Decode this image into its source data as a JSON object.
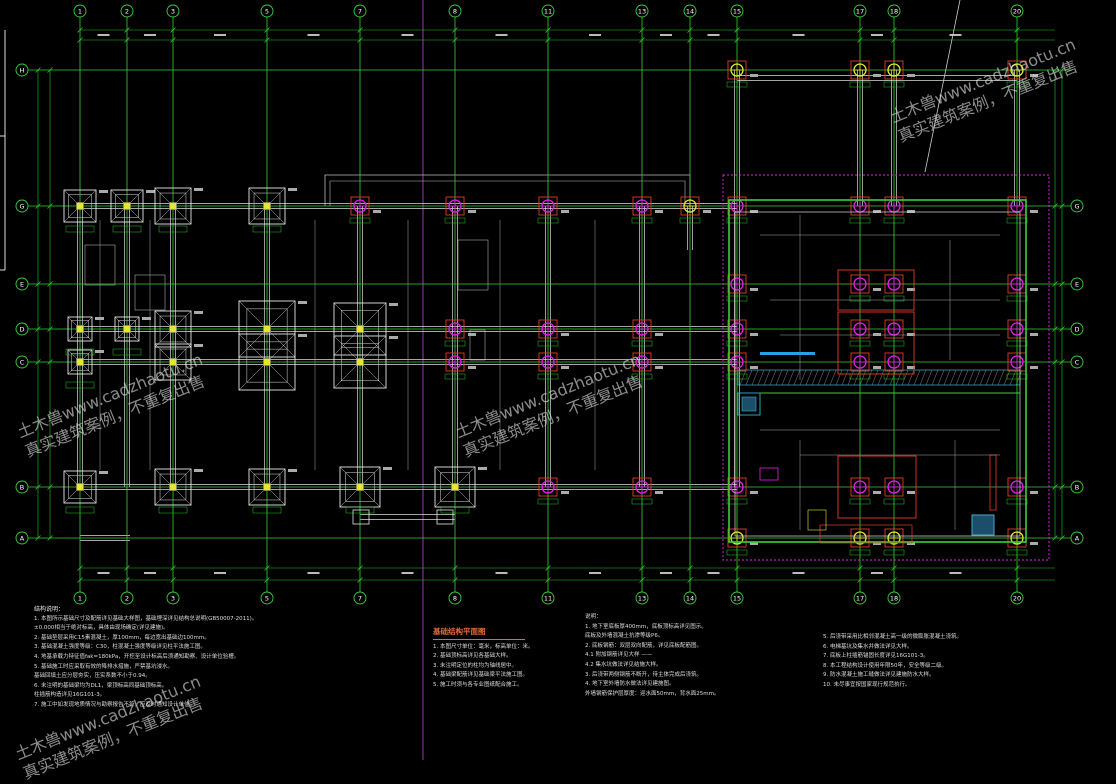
{
  "drawing": {
    "x_axes": [
      "1",
      "2",
      "3",
      "5",
      "7",
      "8",
      "11",
      "13",
      "14",
      "15",
      "17",
      "18",
      "20"
    ],
    "y_axes": [
      "H",
      "G",
      "E",
      "D",
      "C",
      "B",
      "A"
    ],
    "title": "基础结构平面图",
    "general_notes_heading": "结构说明：",
    "notes_left": [
      "1. 本图所示基础尺寸及配筋详见基础大样图，基础埋深详见结构总说明(GB50007-2011)。",
      "   ±0.000相当于绝对标高，具体由现场确定(详见建施)。",
      "2. 基础垫层采用C15素混凝土，厚100mm，每边宽出基础边100mm。",
      "3. 基础混凝土强度等级：C30，柱混凝土强度等级详见柱平法施工图。",
      "4. 地基承载力特征值fak=180kPa，开挖至设计标高后须通知勘察、设计单位验槽。",
      "5. 基础施工时应采取有效的降排水措施，严禁基坑浸水。",
      "   基础回填土应分层夯实，压实系数不小于0.94。",
      "6. 未注明的基础梁均为DL1，梁顶标高同基础顶标高。",
      "   柱插筋构造详见16G101-3。",
      "7. 施工中如发现地质情况与勘察报告不符，应及时通知设计单位。"
    ],
    "notes_mid": [
      "1. 本图尺寸单位：毫米，标高单位：米。",
      "2. 基础顶标高详见各基础大样。",
      "3. 未注明定位的柱均为轴线居中。",
      "4. 基础梁配筋详见基础梁平法施工图。",
      "5. 施工时须与各专业图纸配合施工。"
    ],
    "notes_right": [
      "说明：",
      "1. 地下室底板厚400mm，底板顶标高详见图示。",
      "   底板及外墙混凝土抗渗等级P6。",
      "2. 底板钢筋：双层双向配筋，详见底板配筋图。",
      "   4.1 附加钢筋详见大样 ——",
      "   4.2 集水坑做法详见结施大样。",
      "3. 后浇带两侧钢筋不断开，待主体完成后浇筑。",
      "4. 地下室外墙防水做法详见建施图。",
      "   外墙钢筋保护层厚度：迎水面50mm，背水面25mm。"
    ],
    "notes_far": [
      "5. 后浇带采用比相邻混凝土高一级的微膨胀混凝土浇筑。",
      "6. 电梯基坑及集水井做法详见大样。",
      "7. 底板上柱插筋锚固长度详见16G101-3。",
      "8. 本工程结构设计使用年限50年，安全等级二级。",
      "9. 防水混凝土施工缝做法详见建施防水大样。",
      "10. 未尽事宜按国家现行规范执行。"
    ],
    "watermark": {
      "line1": "土木兽www.cadzhaotu.cn",
      "line2": "真实建筑案例，不重复出售"
    },
    "colors": {
      "axis": "#37d237",
      "dim": "#28c828",
      "concrete": "#dcdcdc",
      "footing": "#e8e8e8",
      "magenta": "#e61ee6",
      "yellow": "#e6e632",
      "red": "#e83a2a",
      "cyan": "#30c8e0",
      "hatch": "#2ea0c0"
    }
  }
}
